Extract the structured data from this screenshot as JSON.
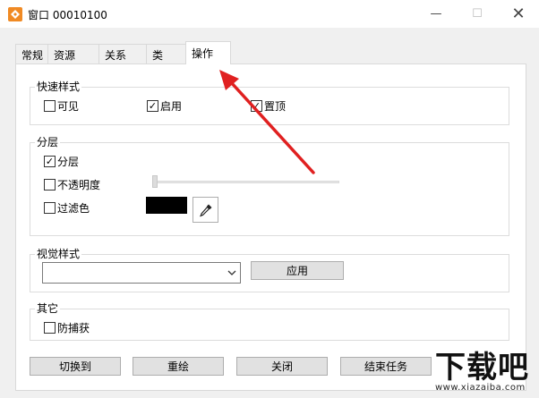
{
  "window": {
    "title": "窗口 00010100",
    "min_glyph": "—",
    "max_glyph": "☐",
    "close_glyph": "✕"
  },
  "tabs": [
    {
      "label": "常规",
      "active": false
    },
    {
      "label": "资源",
      "active": false
    },
    {
      "label": "关系",
      "active": false
    },
    {
      "label": "类",
      "active": false
    },
    {
      "label": "操作",
      "active": true
    }
  ],
  "quick_style": {
    "title": "快速样式",
    "visible": {
      "label": "可见",
      "checked": false
    },
    "enabled": {
      "label": "启用",
      "checked": true
    },
    "topmost": {
      "label": "置顶",
      "checked": true
    }
  },
  "layering": {
    "title": "分层",
    "layered": {
      "label": "分层",
      "checked": true
    },
    "opacity": {
      "label": "不透明度",
      "checked": false
    },
    "filter_color": {
      "label": "过滤色",
      "checked": false
    },
    "swatch_color": "#000000"
  },
  "visual_style": {
    "title": "视觉样式",
    "selected": "",
    "apply_label": "应用"
  },
  "other": {
    "title": "其它",
    "anti_capture": {
      "label": "防捕获",
      "checked": false
    }
  },
  "buttons": {
    "switch_to": "切换到",
    "redraw": "重绘",
    "close": "关闭",
    "end_task": "结束任务"
  },
  "watermark": {
    "logo": "下载吧",
    "url": "www.xiazaiba.com"
  },
  "colors": {
    "annotation_arrow": "#e02020",
    "check_mark": "✓"
  }
}
